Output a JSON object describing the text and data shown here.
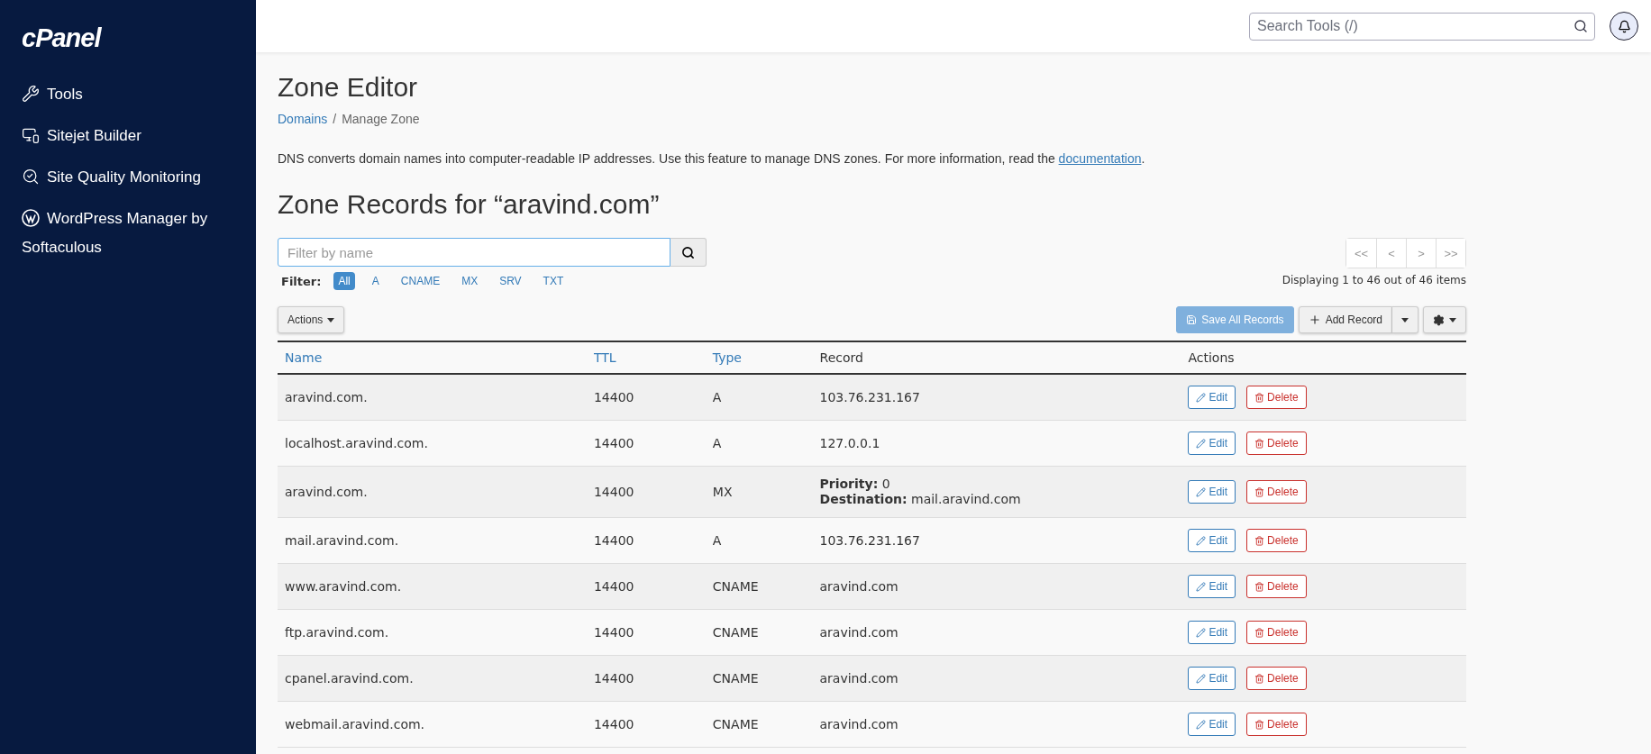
{
  "sidebar": {
    "logo": "cPanel",
    "items": [
      {
        "label": "Tools"
      },
      {
        "label": "Sitejet Builder"
      },
      {
        "label": "Site Quality Monitoring"
      },
      {
        "label": "WordPress Manager by Softaculous"
      }
    ]
  },
  "topbar": {
    "search": {
      "placeholder": "Search Tools (/)"
    }
  },
  "page": {
    "title": "Zone Editor",
    "breadcrumb": [
      {
        "label": "Domains",
        "link": true,
        "separator": "/"
      },
      {
        "label": "Manage Zone",
        "link": false
      }
    ],
    "description": "DNS converts domain names into computer-readable IP addresses. Use this feature to manage DNS zones. For more information, read the ",
    "description_link": "documentation",
    "description_end": ".",
    "heading": "Zone Records for “aravind.com”"
  },
  "filter": {
    "placeholder": "Filter by name",
    "label": "Filter:",
    "types": [
      {
        "label": "All",
        "selected": true
      },
      {
        "label": "A",
        "selected": false
      },
      {
        "label": "CNAME",
        "selected": false
      },
      {
        "label": "MX",
        "selected": false
      },
      {
        "label": "SRV",
        "selected": false
      },
      {
        "label": "TXT",
        "selected": false
      }
    ]
  },
  "pagination": {
    "buttons": [
      "<<",
      "<",
      ">",
      ">>"
    ],
    "summary": "Displaying 1 to 46 out of 46 items"
  },
  "toolbar": {
    "actions": "Actions",
    "save": "Save All Records",
    "add": "Add Record"
  },
  "table": {
    "columns": [
      {
        "label": "Name",
        "sortable": true
      },
      {
        "label": "TTL",
        "sortable": true
      },
      {
        "label": "Type",
        "sortable": true
      },
      {
        "label": "Record",
        "sortable": false
      },
      {
        "label": "Actions",
        "sortable": false
      }
    ],
    "rows": [
      {
        "name": "aravind.com.",
        "ttl": "14400",
        "type": "A",
        "record": [
          "103.76.231.167"
        ],
        "edit": "Edit",
        "delete": "Delete"
      },
      {
        "name": "localhost.aravind.com.",
        "ttl": "14400",
        "type": "A",
        "record": [
          "127.0.0.1"
        ],
        "edit": "Edit",
        "delete": "Delete"
      },
      {
        "name": "aravind.com.",
        "ttl": "14400",
        "type": "MX",
        "record": [
          "**Priority:** 0",
          "**Destination:** mail.aravind.com"
        ],
        "edit": "Edit",
        "delete": "Delete"
      },
      {
        "name": "mail.aravind.com.",
        "ttl": "14400",
        "type": "A",
        "record": [
          "103.76.231.167"
        ],
        "edit": "Edit",
        "delete": "Delete"
      },
      {
        "name": "www.aravind.com.",
        "ttl": "14400",
        "type": "CNAME",
        "record": [
          "aravind.com"
        ],
        "edit": "Edit",
        "delete": "Delete"
      },
      {
        "name": "ftp.aravind.com.",
        "ttl": "14400",
        "type": "CNAME",
        "record": [
          "aravind.com"
        ],
        "edit": "Edit",
        "delete": "Delete"
      },
      {
        "name": "cpanel.aravind.com.",
        "ttl": "14400",
        "type": "CNAME",
        "record": [
          "aravind.com"
        ],
        "edit": "Edit",
        "delete": "Delete"
      },
      {
        "name": "webmail.aravind.com.",
        "ttl": "14400",
        "type": "CNAME",
        "record": [
          "aravind.com"
        ],
        "edit": "Edit",
        "delete": "Delete"
      }
    ]
  }
}
